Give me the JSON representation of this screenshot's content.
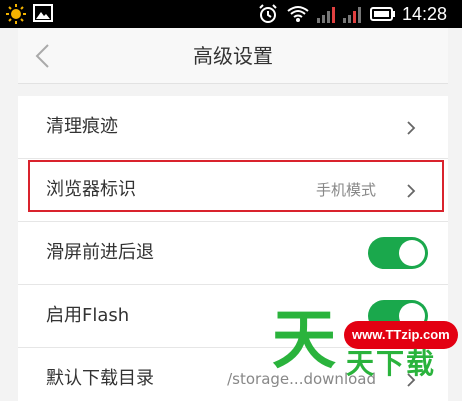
{
  "status_bar": {
    "time": "14:28",
    "icons": [
      "sun-icon",
      "gallery-icon",
      "alarm-icon",
      "wifi-icon",
      "signal-icon",
      "battery-icon"
    ]
  },
  "app_bar": {
    "title": "高级设置",
    "back_icon": "chevron-left-icon"
  },
  "settings": [
    {
      "label": "清理痕迹",
      "type": "link"
    },
    {
      "label": "浏览器标识",
      "value": "手机模式",
      "type": "link",
      "highlighted": true
    },
    {
      "label": "滑屏前进后退",
      "type": "toggle",
      "on": true
    },
    {
      "label": "启用Flash",
      "type": "toggle",
      "on": true
    },
    {
      "label": "默认下载目录",
      "value": "/storage...download",
      "type": "link"
    }
  ],
  "watermark": {
    "url": "www.TTzip.com",
    "big": "天",
    "small": "天下载"
  },
  "colors": {
    "toggle_on": "#1aa84c",
    "highlight_border": "#d9232d",
    "watermark_green": "#2ab33c",
    "watermark_red": "#e30012"
  }
}
